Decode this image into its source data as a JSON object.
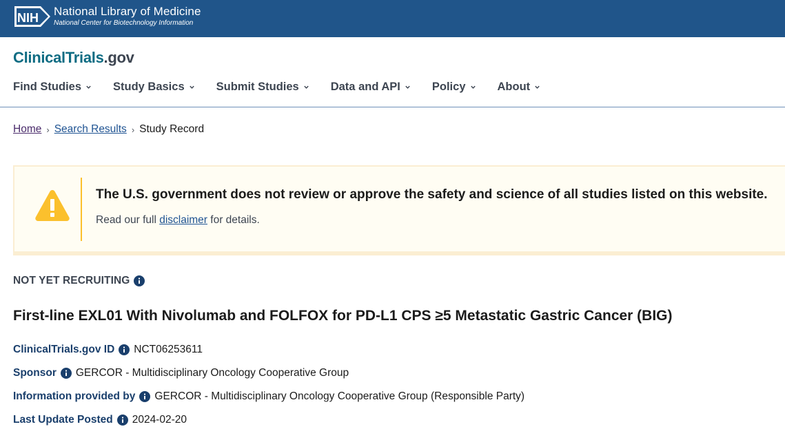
{
  "nih": {
    "logo_text": "NIH",
    "title": "National Library of Medicine",
    "subtitle": "National Center for Biotechnology Information"
  },
  "brand": {
    "name_main": "ClinicalTrials",
    "name_suffix": ".gov"
  },
  "nav": {
    "items": [
      {
        "label": "Find Studies"
      },
      {
        "label": "Study Basics"
      },
      {
        "label": "Submit Studies"
      },
      {
        "label": "Data and API"
      },
      {
        "label": "Policy"
      },
      {
        "label": "About"
      }
    ]
  },
  "breadcrumb": {
    "home": "Home",
    "search_results": "Search Results",
    "current": "Study Record"
  },
  "alert": {
    "heading": "The U.S. government does not review or approve the safety and science of all studies listed on this website.",
    "body_prefix": "Read our full ",
    "link": "disclaimer",
    "body_suffix": " for details.",
    "icon": "warning-icon"
  },
  "study": {
    "status": "NOT YET RECRUITING",
    "title": "First-line EXL01 With Nivolumab and FOLFOX for PD-L1 CPS ≥5 Metastatic Gastric Cancer (BIG)",
    "facts": [
      {
        "label": "ClinicalTrials.gov ID",
        "value": "NCT06253611"
      },
      {
        "label": "Sponsor",
        "value": "GERCOR - Multidisciplinary Oncology Cooperative Group"
      },
      {
        "label": "Information provided by",
        "value": "GERCOR - Multidisciplinary Oncology Cooperative Group (Responsible Party)"
      },
      {
        "label": "Last Update Posted",
        "value": "2024-02-20"
      }
    ]
  },
  "colors": {
    "nih_bar": "#20558a",
    "link": "#205493",
    "warning": "#fbc02d",
    "fact_label": "#1a3f6c"
  }
}
